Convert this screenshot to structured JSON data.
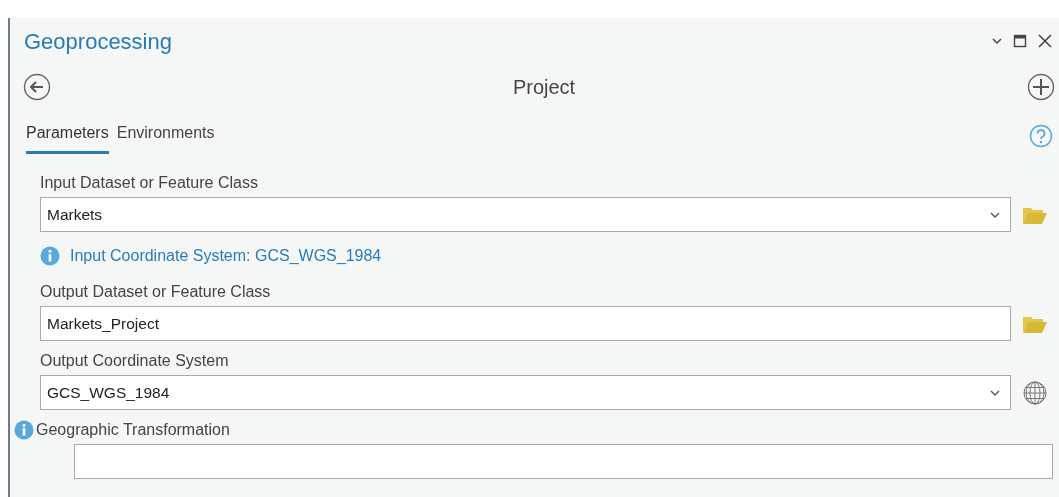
{
  "pane": {
    "title": "Geoprocessing",
    "tool_title": "Project"
  },
  "tabs": [
    {
      "label": "Parameters",
      "selected": true
    },
    {
      "label": "Environments",
      "selected": false
    }
  ],
  "parameters": [
    {
      "kind": "field",
      "label": "Input Dataset or Feature Class",
      "value": "Markets",
      "dropdown": true,
      "button": {
        "kind": "folder"
      },
      "message": "Input Coordinate System: GCS_WGS_1984"
    },
    {
      "kind": "field",
      "label": "Output Dataset or Feature Class",
      "value": "Markets_Project",
      "dropdown": false,
      "button": {
        "kind": "folder"
      }
    },
    {
      "kind": "field",
      "label": "Output Coordinate System",
      "value": "GCS_WGS_1984",
      "dropdown": true,
      "button": {
        "kind": "globe"
      }
    },
    {
      "kind": "info_field",
      "label": "Geographic Transformation",
      "dropdown": false
    }
  ]
}
